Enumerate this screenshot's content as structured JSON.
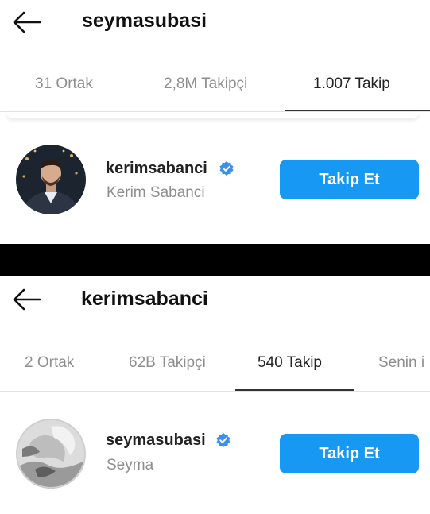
{
  "colors": {
    "accent": "#1798f2",
    "verified": "#3a8ff0",
    "muted_text": "#8e8e8e",
    "divider": "#000000"
  },
  "panels": [
    {
      "header": {
        "back_icon": "arrow-left-icon",
        "title": "seymasubasi"
      },
      "tabs": [
        {
          "label": "31 Ortak",
          "active": false
        },
        {
          "label": "2,8M Takipçi",
          "active": false
        },
        {
          "label": "1.007 Takip",
          "active": true
        }
      ],
      "user": {
        "username": "kerimsabanci",
        "full_name": "Kerim Sabanci",
        "verified": true,
        "avatar_icon": "profile-photo",
        "button": "Takip Et"
      }
    },
    {
      "header": {
        "back_icon": "arrow-left-icon",
        "title": "kerimsabanci"
      },
      "tabs": [
        {
          "label": "2 Ortak",
          "active": false
        },
        {
          "label": "62B Takipçi",
          "active": false
        },
        {
          "label": "540 Takip",
          "active": true
        },
        {
          "label": "Senin i",
          "active": false
        }
      ],
      "user": {
        "username": "seymasubasi",
        "full_name": "Seyma",
        "verified": true,
        "avatar_icon": "profile-photo",
        "button": "Takip Et"
      }
    }
  ]
}
